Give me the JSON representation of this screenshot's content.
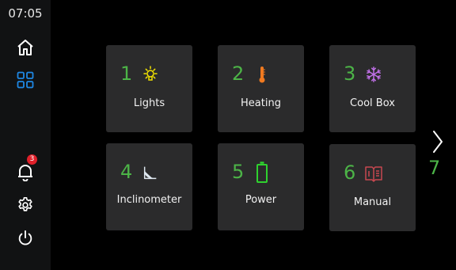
{
  "status": {
    "time": "07:05"
  },
  "sidebar": {
    "items": [
      {
        "name": "home",
        "icon": "home-icon"
      },
      {
        "name": "apps",
        "icon": "grid-icon",
        "active": true,
        "color": "#1e88e5"
      },
      {
        "name": "notifications",
        "icon": "bell-icon",
        "badge": "3"
      },
      {
        "name": "settings",
        "icon": "gear-icon"
      },
      {
        "name": "power",
        "icon": "power-icon"
      }
    ]
  },
  "tiles": [
    {
      "number": "1",
      "label": "Lights",
      "icon": "light-bulb-icon",
      "icon_color": "#f2e200"
    },
    {
      "number": "2",
      "label": "Heating",
      "icon": "thermometer-icon",
      "icon_color": "#f07a20"
    },
    {
      "number": "3",
      "label": "Cool Box",
      "icon": "snowflake-icon",
      "icon_color": "#c070e8"
    },
    {
      "number": "4",
      "label": "Inclinometer",
      "icon": "angle-icon",
      "icon_color": "#dfe8f0"
    },
    {
      "number": "5",
      "label": "Power",
      "icon": "battery-icon",
      "icon_color": "#2fd12f"
    },
    {
      "number": "6",
      "label": "Manual",
      "icon": "book-icon",
      "icon_color": "#c84850"
    }
  ],
  "pager": {
    "next_number": "7",
    "next_icon": "chevron-right-icon"
  },
  "colors": {
    "accent_green": "#4cb447",
    "tile_bg": "#2b2b2c",
    "sidebar_bg": "#111213"
  }
}
